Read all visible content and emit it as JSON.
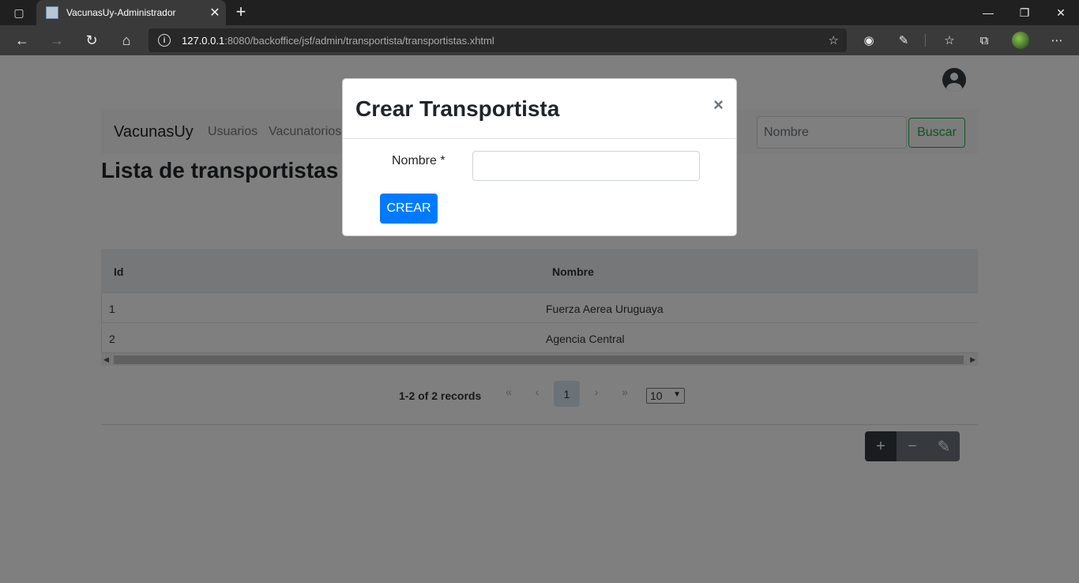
{
  "browser": {
    "tab_title": "VacunasUy-Administrador",
    "url_host": "127.0.0.1",
    "url_rest": ":8080/backoffice/jsf/admin/transportista/transportistas.xhtml"
  },
  "navbar": {
    "brand": "VacunasUy",
    "links": [
      "Usuarios",
      "Vacunatorios"
    ],
    "search_placeholder": "Nombre",
    "search_button": "Buscar"
  },
  "page": {
    "title": "Lista de transportistas"
  },
  "table": {
    "columns": [
      "Id",
      "Nombre"
    ],
    "rows": [
      {
        "id": "1",
        "nombre": "Fuerza Aerea Uruguaya"
      },
      {
        "id": "2",
        "nombre": "Agencia Central"
      }
    ]
  },
  "paginator": {
    "records_text": "1-2 of 2 records",
    "first": "«",
    "prev": "‹",
    "current_page": "1",
    "next": "›",
    "last": "»",
    "rows_per_page": "10"
  },
  "actions": {
    "add": "+",
    "remove": "−",
    "edit": "✎"
  },
  "modal": {
    "title": "Crear Transportista",
    "close": "×",
    "field_label": "Nombre *",
    "field_value": "",
    "submit": "CREAR"
  },
  "colors": {
    "primary": "#007bff",
    "success": "#28a745",
    "dark": "#343a40",
    "secondary": "#6c757d"
  }
}
